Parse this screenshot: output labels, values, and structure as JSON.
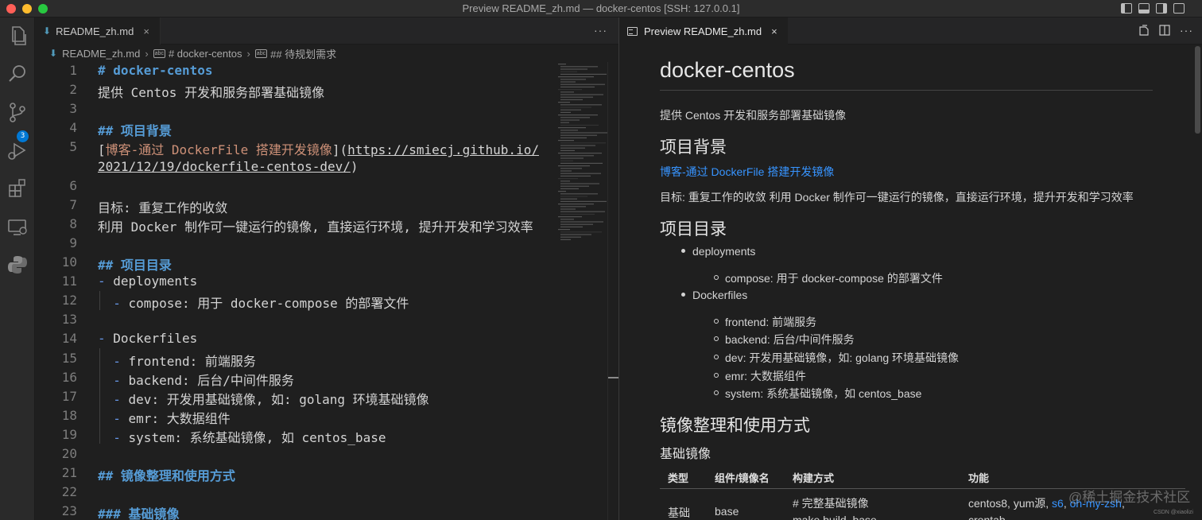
{
  "window": {
    "title": "Preview README_zh.md — docker-centos [SSH: 127.0.0.1]",
    "traffic_colors": [
      "#ff5f57",
      "#febc2e",
      "#28c840"
    ]
  },
  "activity_bar": {
    "items": [
      "explorer-icon",
      "search-icon",
      "source-control-icon",
      "run-debug-icon",
      "extensions-icon",
      "remote-explorer-icon",
      "python-icon"
    ],
    "scm_badge": "3"
  },
  "left_editor": {
    "tab": {
      "label": "README_zh.md",
      "close": "×"
    },
    "more": "···",
    "breadcrumb": {
      "file": "README_zh.md",
      "symbol_badge": "abc",
      "items": [
        "# docker-centos",
        "## 待规划需求"
      ]
    },
    "lines": [
      {
        "num": "1",
        "parts": [
          {
            "t": "# docker-centos",
            "c": "h"
          }
        ]
      },
      {
        "num": "2",
        "parts": [
          {
            "t": "提供 Centos 开发和服务部署基础镜像",
            "c": ""
          }
        ]
      },
      {
        "num": "3",
        "parts": []
      },
      {
        "num": "4",
        "parts": [
          {
            "t": "## 项目背景",
            "c": "h"
          }
        ]
      },
      {
        "num": "5",
        "parts": [
          {
            "t": "[",
            "c": ""
          },
          {
            "t": "博客-通过 DockerFile 搭建开发镜像",
            "c": "lk"
          },
          {
            "t": "](",
            "c": ""
          },
          {
            "t": "https://smiecj.github.io/",
            "c": "url"
          }
        ]
      },
      {
        "num": "",
        "parts": [
          {
            "t": "2021/12/19/dockerfile-centos-dev/",
            "c": "url"
          },
          {
            "t": ")",
            "c": ""
          }
        ]
      },
      {
        "num": "6",
        "parts": []
      },
      {
        "num": "7",
        "parts": [
          {
            "t": "目标: 重复工作的收敛",
            "c": ""
          }
        ]
      },
      {
        "num": "8",
        "parts": [
          {
            "t": "利用 Docker 制作可一键运行的镜像, 直接运行环境, 提升开发和学习效率",
            "c": ""
          }
        ]
      },
      {
        "num": "9",
        "parts": []
      },
      {
        "num": "10",
        "parts": [
          {
            "t": "## 项目目录",
            "c": "h"
          }
        ]
      },
      {
        "num": "11",
        "parts": [
          {
            "t": "-",
            "c": "bul"
          },
          {
            "t": " deployments",
            "c": ""
          }
        ]
      },
      {
        "num": "12",
        "parts": [
          {
            "t": "  ",
            "c": ""
          },
          {
            "t": "-",
            "c": "bul"
          },
          {
            "t": " compose: 用于 docker-compose 的部署文件",
            "c": ""
          }
        ]
      },
      {
        "num": "13",
        "parts": []
      },
      {
        "num": "14",
        "parts": [
          {
            "t": "-",
            "c": "bul"
          },
          {
            "t": " Dockerfiles",
            "c": ""
          }
        ]
      },
      {
        "num": "15",
        "parts": [
          {
            "t": "  ",
            "c": ""
          },
          {
            "t": "-",
            "c": "bul"
          },
          {
            "t": " frontend: 前端服务",
            "c": ""
          }
        ]
      },
      {
        "num": "16",
        "parts": [
          {
            "t": "  ",
            "c": ""
          },
          {
            "t": "-",
            "c": "bul"
          },
          {
            "t": " backend: 后台/中间件服务",
            "c": ""
          }
        ]
      },
      {
        "num": "17",
        "parts": [
          {
            "t": "  ",
            "c": ""
          },
          {
            "t": "-",
            "c": "bul"
          },
          {
            "t": " dev: 开发用基础镜像, 如: golang 环境基础镜像",
            "c": ""
          }
        ]
      },
      {
        "num": "18",
        "parts": [
          {
            "t": "  ",
            "c": ""
          },
          {
            "t": "-",
            "c": "bul"
          },
          {
            "t": " emr: 大数据组件",
            "c": ""
          }
        ]
      },
      {
        "num": "19",
        "parts": [
          {
            "t": "  ",
            "c": ""
          },
          {
            "t": "-",
            "c": "bul"
          },
          {
            "t": " system: 系统基础镜像, 如 centos_base",
            "c": ""
          }
        ]
      },
      {
        "num": "20",
        "parts": []
      },
      {
        "num": "21",
        "parts": [
          {
            "t": "## 镜像整理和使用方式",
            "c": "h"
          }
        ]
      },
      {
        "num": "22",
        "parts": []
      },
      {
        "num": "23",
        "parts": [
          {
            "t": "### 基础镜像",
            "c": "h"
          }
        ]
      }
    ]
  },
  "right_preview": {
    "tab": {
      "label": "Preview README_zh.md",
      "close": "×"
    },
    "h1": "docker-centos",
    "intro": "提供 Centos 开发和服务部署基础镜像",
    "h2_background": "项目背景",
    "blog_link": "博客-通过 DockerFile 搭建开发镜像",
    "goal": "目标: 重复工作的收敛 利用 Docker 制作可一键运行的镜像，直接运行环境，提升开发和学习效率",
    "h2_dirs": "项目目录",
    "bullet_deployments": "deployments",
    "sub_compose": "compose: 用于 docker-compose 的部署文件",
    "bullet_dockerfiles": "Dockerfiles",
    "sub_items": [
      "frontend: 前端服务",
      "backend: 后台/中间件服务",
      "dev: 开发用基础镜像，如: golang 环境基础镜像",
      "emr: 大数据组件",
      "system: 系统基础镜像，如 centos_base"
    ],
    "h2_images": "镜像整理和使用方式",
    "h3_base": "基础镜像",
    "table": {
      "headers": [
        "类型",
        "组件/镜像名",
        "构建方式",
        "功能"
      ],
      "row1": {
        "type": "基础",
        "name": "base",
        "build_line1": "# 完整基础镜像",
        "build_line2": "make build_base",
        "feature_text": "centos8, yum源, ",
        "feature_link1": "s6",
        "feature_sep": ", ",
        "feature_link2": "oh-my-zsh",
        "feature_tail": ",",
        "feature_line2": "crontab"
      }
    }
  },
  "watermark": "@稀土掘金技术社区",
  "csdn_mark": "CSDN @xiaolizi"
}
